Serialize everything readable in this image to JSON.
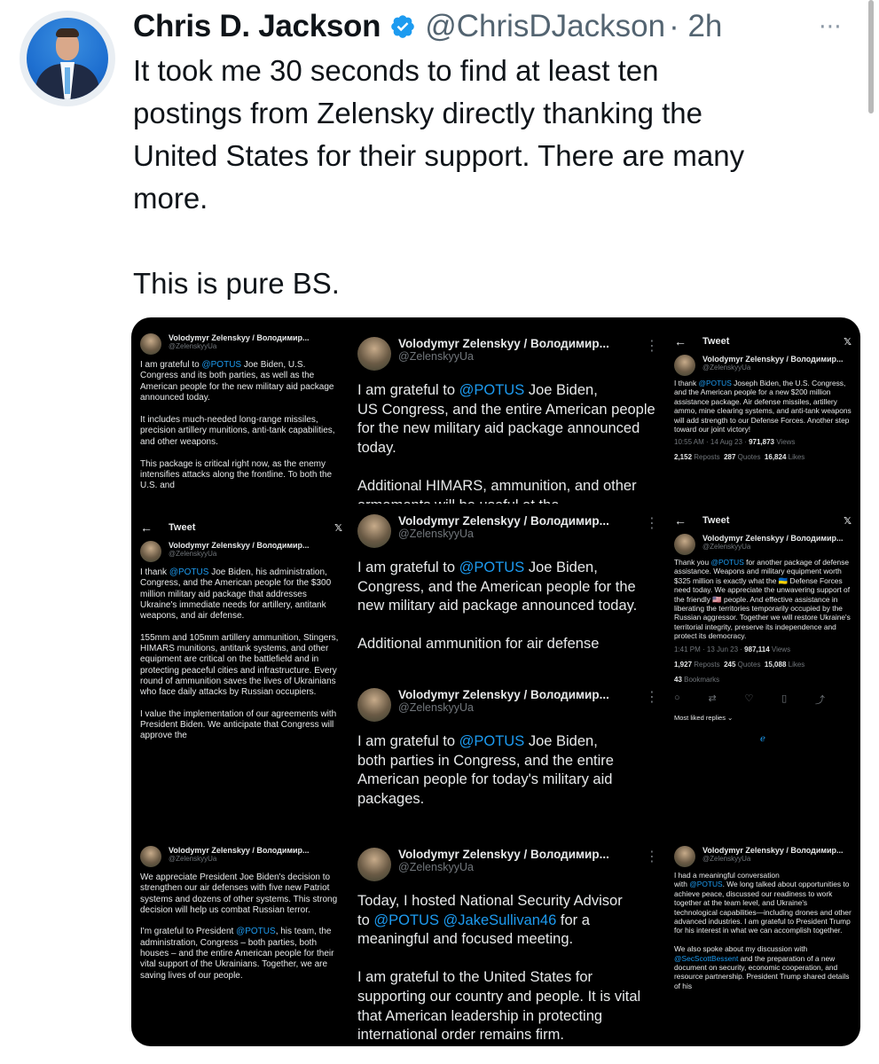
{
  "author": {
    "name": "Chris D. Jackson",
    "handle": "@ChrisDJackson",
    "time": "· 2h",
    "more_icon": "⋯"
  },
  "tweet": {
    "text": "It took me 30 seconds to find at least ten\npostings from Zelensky directly thanking the\nUnited States for their support. There are many\nmore.\n\nThis is pure BS."
  },
  "embedded": {
    "name": "Volodymyr Zelenskyy / Володимир...",
    "handle": "@ZelenskyyUa",
    "topbar_title": "Tweet",
    "x_logo": "𝕏",
    "back_arrow": "←",
    "panel1": {
      "p1": "I am grateful to ",
      "m1": "@POTUS",
      "p2": " Joe Biden, U.S. Congress and its both parties, as well as the American people for the new military aid package announced today.\n\nIt includes much-needed long-range missiles, precision artillery munitions, anti-tank capabilities, and other weapons.\n\nThis package is critical right now, as the enemy intensifies attacks along the frontline. To both the U.S. and"
    },
    "panel2": {
      "p1": "I am grateful to ",
      "m1": "@POTUS",
      "p2": " Joe Biden,\nUS Congress, and the entire American people for the new military aid package announced today.\n\nAdditional HIMARS, ammunition, and other armaments will be useful at the"
    },
    "panel3": {
      "p1": "I thank ",
      "m1": "@POTUS",
      "p2": " Joseph Biden, the U.S. Congress, and the American people for a new $200 million assistance package. Air defense missiles, artillery ammo, mine clearing systems, and anti-tank weapons will add strength to our Defense Forces. Another step toward our joint victory!",
      "time": "10:55 AM · 14 Aug 23 ·",
      "views": "971,873",
      "views_label": "Views",
      "reposts": "2,152",
      "reposts_label": "Reposts",
      "quotes": "287",
      "quotes_label": "Quotes",
      "likes": "16,824",
      "likes_label": "Likes"
    },
    "panel4": {
      "p1": "I thank ",
      "m1": "@POTUS",
      "p2": " Joe Biden, his administration, Congress, and the American people for the $300 million military aid package that addresses Ukraine's immediate needs for artillery, antitank weapons, and air defense.\n\n155mm and 105mm artillery ammunition, Stingers, HIMARS munitions, antitank systems, and other equipment are critical on the battlefield and in protecting peaceful cities and infrastructure. Every round of ammunition saves the lives of Ukrainians who face daily attacks by Russian occupiers.\n\nI value the implementation of our agreements with President Biden. We anticipate that Congress will approve the"
    },
    "panel5": {
      "p1": "I am grateful to ",
      "m1": "@POTUS",
      "p2": " Joe Biden,\nCongress, and the American people for the new military aid package announced today.\n\nAdditional ammunition for air defense"
    },
    "panel6": {
      "p1": "Thank you ",
      "m1": "@POTUS",
      "p2": " for another package of defense assistance. Weapons and military equipment worth $325 million is exactly what the 🇺🇦 Defense Forces need today. We appreciate the unwavering support of the friendly 🇺🇸 people. And effective assistance in liberating the territories temporarily occupied by the Russian aggressor. Together we will restore Ukraine's territorial integrity, preserve its independence and protect its democracy.",
      "time": "1:41 PM · 13 Jun 23 ·",
      "views": "987,114",
      "views_label": "Views",
      "reposts": "1,927",
      "reposts_label": "Reposts",
      "quotes": "245",
      "quotes_label": "Quotes",
      "likes": "15,088",
      "likes_label": "Likes",
      "bookmarks": "43",
      "bookmarks_label": "Bookmarks",
      "replies_sort": "Most liked replies ⌄"
    },
    "panel7": {
      "p1": "I am grateful to ",
      "m1": "@POTUS",
      "p2": " Joe Biden,\nboth parties in Congress, and the entire American people for today's military aid packages."
    },
    "panel8": {
      "p1": "We appreciate President Joe Biden's decision to strengthen our air defenses with five new Patriot systems and dozens of other systems. This strong decision will help us combat Russian terror.\n\nI'm grateful to President ",
      "m1": "@POTUS",
      "p2": ", his team, the administration, Congress – both parties, both houses – and the entire American people for their vital support of the Ukrainians. Together, we are saving lives of our people."
    },
    "panel9": {
      "p1": "Today, I hosted National Security Advisor\nto ",
      "m1": "@POTUS",
      "m2": " @JakeSullivan46",
      "p2": " for a meaningful and focused meeting.\n\nI am grateful to the United States for supporting our country and people. It is vital that American leadership in protecting international order remains firm."
    },
    "panel10": {
      "p1": "I had a meaningful conversation\nwith ",
      "m1": "@POTUS",
      "p2": ". We long talked about opportunities to achieve peace, discussed our readiness to work together at the team level, and Ukraine's technological capabilities—including drones and other advanced industries. I am grateful to President Trump for his interest in what we can accomplish together.\n\nWe also spoke about my discussion with\n",
      "m2": "@SecScottBessent",
      "p3": " and the preparation of a new document on security, economic cooperation, and resource partnership. President Trump shared details of his"
    }
  },
  "colors": {
    "verified_blue": "#1d9bf0",
    "handle_gray": "#536471",
    "mention_blue": "#1d9bf0"
  }
}
